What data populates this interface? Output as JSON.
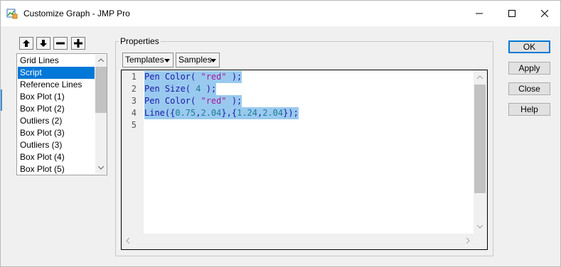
{
  "window": {
    "title": "Customize Graph - JMP Pro",
    "controls": {
      "minimize_icon": "minimize-icon",
      "maximize_icon": "maximize-icon",
      "close_icon": "close-icon"
    }
  },
  "toolbar": {
    "buttons": [
      {
        "name": "move-up-button",
        "icon": "arrow-up-icon"
      },
      {
        "name": "move-down-button",
        "icon": "arrow-down-icon"
      },
      {
        "name": "remove-button",
        "icon": "minus-icon"
      },
      {
        "name": "add-button",
        "icon": "plus-icon"
      }
    ]
  },
  "element_list": {
    "items": [
      "Grid Lines",
      "Script",
      "Reference Lines",
      "Box Plot (1)",
      "Box Plot (2)",
      "Outliers (2)",
      "Box Plot (3)",
      "Outliers (3)",
      "Box Plot (4)",
      "Box Plot (5)"
    ],
    "selected": "Script"
  },
  "properties": {
    "label": "Properties",
    "templates_label": "Templates",
    "samples_label": "Samples"
  },
  "editor": {
    "line_numbers": [
      "1",
      "2",
      "3",
      "4",
      "5"
    ],
    "lines": [
      "Pen Color( \"red\" );",
      "Pen Size( 4 );",
      "Pen Color( \"red\" );",
      "Line({0.75,2.04},{1.24,2.04});",
      ""
    ],
    "tokens": {
      "l1": [
        "Pen Color(",
        " ",
        "\"red\"",
        " );"
      ],
      "l2": [
        "Pen Size(",
        " ",
        "4",
        " );"
      ],
      "l3": [
        "Pen Color(",
        " ",
        "\"red\"",
        " );"
      ],
      "l4": [
        "Line({",
        "0.75",
        ",",
        "2.04",
        "},{",
        "1.24",
        ",",
        "2.04",
        "});"
      ]
    }
  },
  "buttons": {
    "ok": "OK",
    "apply": "Apply",
    "close": "Close",
    "help": "Help"
  },
  "colors": {
    "selection": "#0078d7",
    "code_highlight": "#99c9ef",
    "keyword": "#1a1aa6",
    "string": "#a51c9d",
    "number": "#1e7d93"
  }
}
